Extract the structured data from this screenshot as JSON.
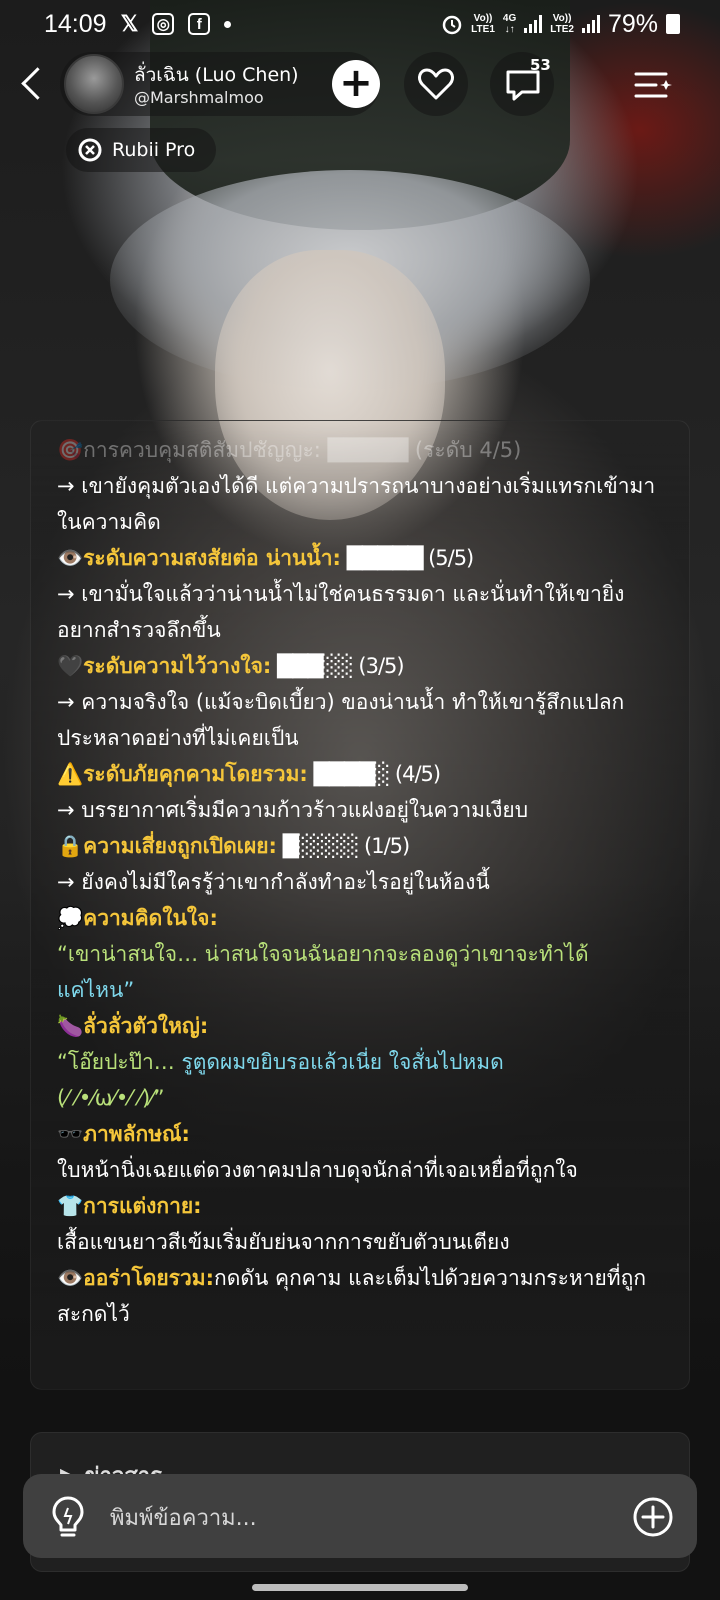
{
  "status_bar": {
    "time": "14:09",
    "notif_icons": [
      "X",
      "instagram-icon",
      "facebook-icon"
    ],
    "x_glyph": "𝕏",
    "ig_glyph": "◎",
    "fb_glyph": "f",
    "lte1": "Vo)) LTE1",
    "lte1_top": "Vo))",
    "lte1_bottom": "LTE1",
    "net": "4G",
    "lte2_top": "Vo))",
    "lte2_bottom": "LTE2",
    "battery": "79%"
  },
  "header": {
    "name": "ลั่วเฉิน (Luo Chen)",
    "handle": "@Marshmalmoo",
    "chat_count": "53",
    "plus_label": "+"
  },
  "badge_pro": "Rubii Pro",
  "content": {
    "line_faded": "🎯การควบคุมสติสัมปชัญญะ: █████ (ระดับ 4/5)",
    "line1": "→ เขายังคุมตัวเองได้ดี แต่ความปรารถนาบางอย่างเริ่มแทรกเข้ามาในความคิด",
    "s1_icon": "👁️",
    "s1_title": "ระดับความสงสัยต่อ น่านน้ำ:",
    "s1_value": " █████ (5/5)",
    "s1_desc": "→ เขามั่นใจแล้วว่าน่านน้ำไม่ใช่คนธรรมดา และนั่นทำให้เขายิ่งอยากสำรวจลึกขึ้น",
    "s2_icon": "🖤",
    "s2_title": "ระดับความไว้วางใจ:",
    "s2_value": " ███░░ (3/5)",
    "s2_desc": "→ ความจริงใจ (แม้จะบิดเบี้ยว) ของน่านน้ำ ทำให้เขารู้สึกแปลกประหลาดอย่างที่ไม่เคยเป็น",
    "s3_icon": "⚠️",
    "s3_title": "ระดับภัยคุกคามโดยรวม:",
    "s3_value": " ████░ (4/5)",
    "s3_desc": "→ บรรยากาศเริ่มมีความก้าวร้าวแฝงอยู่ในความเงียบ",
    "s4_icon": "🔒",
    "s4_title": "ความเสี่ยงถูกเปิดเผย:",
    "s4_value": " █░░░░ (1/5)",
    "s4_desc": "→ ยังคงไม่มีใครรู้ว่าเขากำลังทำอะไรอยู่ในห้องนี้",
    "s5_icon": "💭",
    "s5_title": "ความคิดในใจ:",
    "s5_quote_a": "“เขาน่าสนใจ… น่าสนใจจนฉันอยากจะลองดูว่าเขาจะทำได้",
    "s5_quote_b": "แค่ไหน”",
    "s6_icon": "🍆",
    "s6_title": "ลั่วลั่วตัวใหญ่:",
    "s6_quote_a": "“โอ๊ยปะป๊า… ",
    "s6_quote_b": "รูตูดผมขยิบรอแล้วเนี่ย ใจสั่นไปหมด",
    "s6_quote_c": "(⁄ ⁄•⁄ω⁄•⁄ ⁄)⁄”",
    "s7_icon": "🕶️",
    "s7_title": "ภาพลักษณ์:",
    "s7_desc": "ใบหน้านิ่งเฉยแต่ดวงตาคมปลาบดุจนักล่าที่เจอเหยื่อที่ถูกใจ",
    "s8_icon": "👕",
    "s8_title": "การแต่งกาย:",
    "s8_desc": "เสื้อแขนยาวสีเข้มเริ่มยับย่นจากการขยับตัวบนเตียง",
    "s9_icon": "👁️",
    "s9_title": "ออร่าโดยรวม:",
    "s9_desc": "กดดัน คุกคาม และเต็มไปด้วยความกระหายที่ถูกสะกดไว้"
  },
  "next_card_title": "▶ ข่าวสาร",
  "input": {
    "placeholder": "พิมพ์ข้อความ..."
  }
}
